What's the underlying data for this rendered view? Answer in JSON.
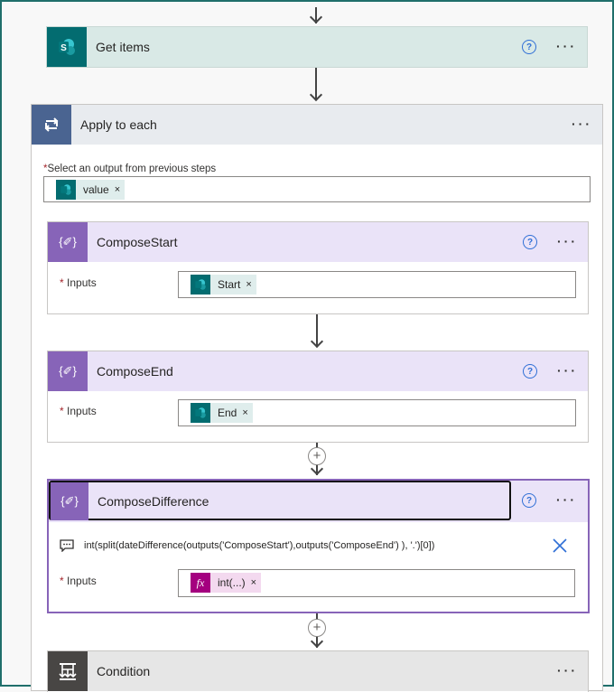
{
  "get_items": {
    "title": "Get items"
  },
  "apply_each": {
    "title": "Apply to each",
    "select_label": "Select an output from previous steps",
    "required_mark": "*",
    "token": {
      "label": "value",
      "remove": "×"
    }
  },
  "compose_start": {
    "title": "ComposeStart",
    "inputs_label": "Inputs",
    "token": {
      "label": "Start",
      "remove": "×"
    }
  },
  "compose_end": {
    "title": "ComposeEnd",
    "inputs_label": "Inputs",
    "token": {
      "label": "End",
      "remove": "×"
    }
  },
  "compose_diff": {
    "title": "ComposeDifference",
    "expression": "int(split(dateDifference(outputs('ComposeStart'),outputs('ComposeEnd') ), '.')[0])",
    "inputs_label": "Inputs",
    "token": {
      "label": "int(...)",
      "remove": "×",
      "icon_text": "fx"
    }
  },
  "condition": {
    "title": "Condition"
  },
  "common": {
    "help": "?",
    "more": "···",
    "plus": "+",
    "sp_letter": "S",
    "compose_glyph": "{✐}"
  },
  "colors": {
    "sharepoint": "#036c70",
    "compose": "#8764b8",
    "apply_each": "#4a6491",
    "condition": "#484644",
    "expression": "#a4007f",
    "help": "#2f6fd6"
  },
  "icons": {
    "sharepoint": "sharepoint-icon",
    "loop": "loop-icon",
    "compose": "compose-icon",
    "expression": "fx-icon",
    "condition": "condition-icon",
    "comment": "comment-icon",
    "close": "close-icon"
  }
}
